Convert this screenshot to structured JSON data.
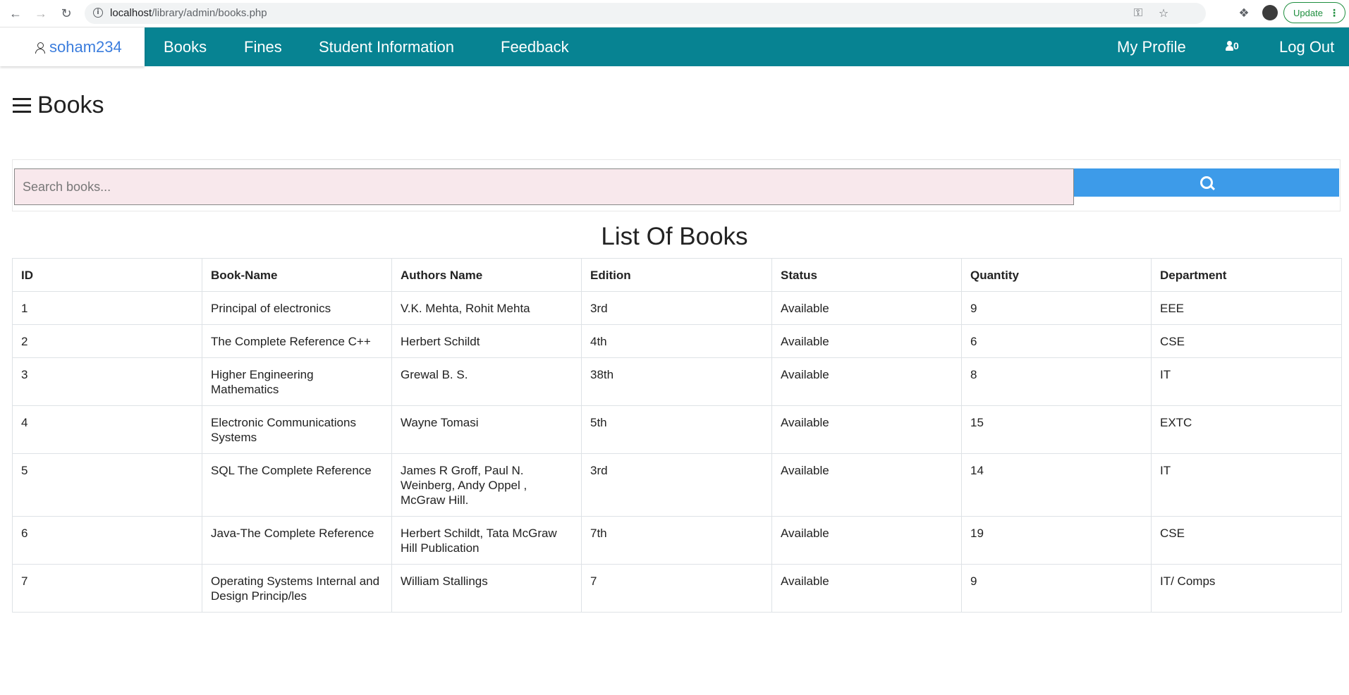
{
  "browser": {
    "url_host": "localhost",
    "url_path": "/library/admin/books.php",
    "update_label": "Update"
  },
  "navbar": {
    "brand": "soham234",
    "items": [
      "Books",
      "Fines",
      "Student Information",
      "Feedback"
    ],
    "my_profile": "My Profile",
    "notification_count": "0",
    "logout": "Log Out",
    "color": "#078392"
  },
  "page": {
    "title": "Books"
  },
  "search": {
    "placeholder": "Search books...",
    "button_color": "#3d9be9"
  },
  "table": {
    "title": "List Of Books",
    "headers": [
      "ID",
      "Book-Name",
      "Authors Name",
      "Edition",
      "Status",
      "Quantity",
      "Department"
    ],
    "rows": [
      [
        "1",
        "Principal of electronics",
        "V.K. Mehta, Rohit Mehta",
        "3rd",
        "Available",
        "9",
        "EEE"
      ],
      [
        "2",
        "The Complete Reference C++",
        "Herbert Schildt",
        "4th",
        "Available",
        "6",
        "CSE"
      ],
      [
        "3",
        "Higher Engineering Mathematics",
        "Grewal B. S.",
        "38th",
        "Available",
        "8",
        "IT"
      ],
      [
        "4",
        "Electronic Communications Systems",
        "Wayne Tomasi",
        "5th",
        "Available",
        "15",
        "EXTC"
      ],
      [
        "5",
        "SQL The Complete Reference",
        "James R Groff, Paul N. Weinberg, Andy Oppel , McGraw Hill.",
        "3rd",
        "Available",
        "14",
        "IT"
      ],
      [
        "6",
        "Java-The Complete Reference",
        "Herbert Schildt, Tata McGraw Hill Publication",
        "7th",
        "Available",
        "19",
        "CSE"
      ],
      [
        "7",
        "Operating Systems Internal and Design Princip/les",
        "William Stallings",
        "7",
        "Available",
        "9",
        "IT/ Comps"
      ]
    ]
  }
}
